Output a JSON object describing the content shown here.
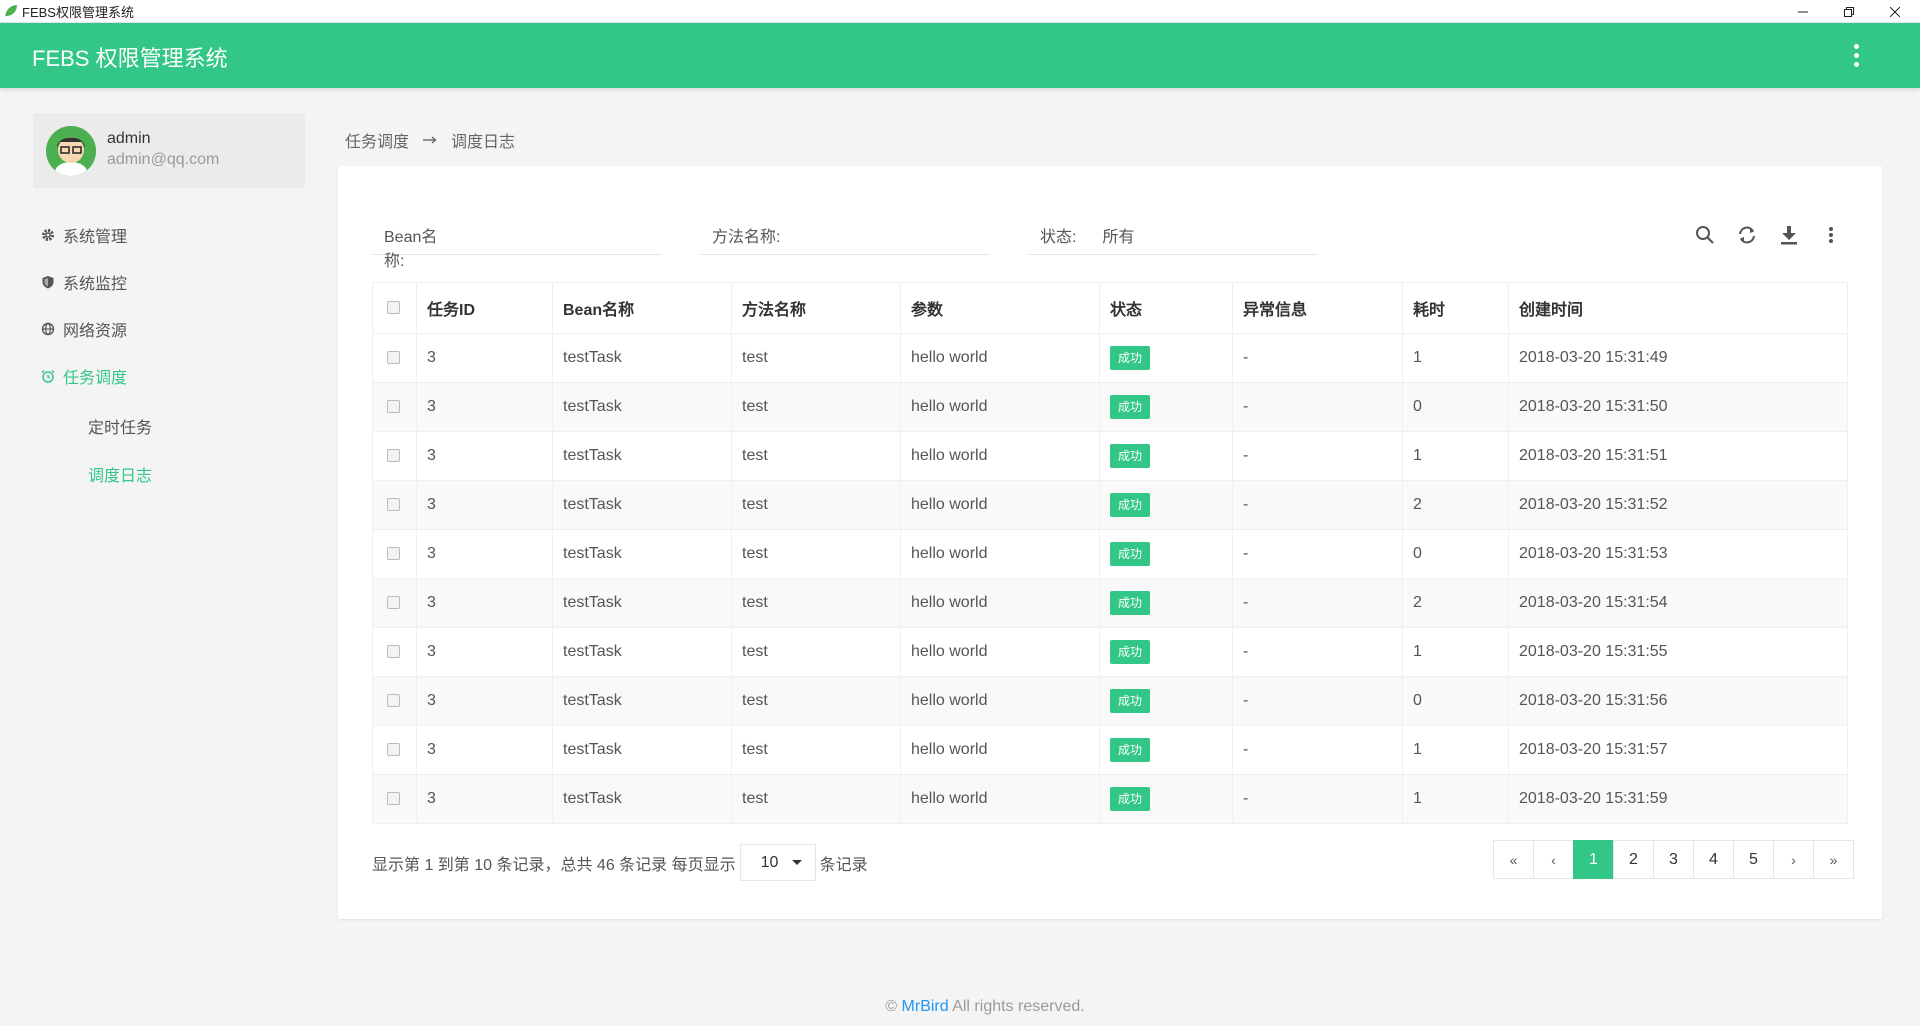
{
  "window": {
    "title": "FEBS权限管理系统"
  },
  "header": {
    "brand": "FEBS 权限管理系统"
  },
  "user": {
    "name": "admin",
    "email": "admin@qq.com"
  },
  "sidebar": {
    "items": [
      {
        "label": "系统管理",
        "icon": "gear-icon"
      },
      {
        "label": "系统监控",
        "icon": "shield-icon"
      },
      {
        "label": "网络资源",
        "icon": "globe-icon"
      },
      {
        "label": "任务调度",
        "icon": "alarm-clock-icon"
      }
    ],
    "subitems": [
      {
        "label": "定时任务"
      },
      {
        "label": "调度日志"
      }
    ]
  },
  "breadcrumb": {
    "parent": "任务调度",
    "current": "调度日志"
  },
  "filters": {
    "bean_label": "Bean名称:",
    "method_label": "方法名称:",
    "status_label": "状态:",
    "status_value": "所有"
  },
  "table": {
    "columns": [
      "任务ID",
      "Bean名称",
      "方法名称",
      "参数",
      "状态",
      "异常信息",
      "耗时",
      "创建时间"
    ],
    "rows": [
      [
        "3",
        "testTask",
        "test",
        "hello world",
        "成功",
        "-",
        "1",
        "2018-03-20 15:31:49"
      ],
      [
        "3",
        "testTask",
        "test",
        "hello world",
        "成功",
        "-",
        "0",
        "2018-03-20 15:31:50"
      ],
      [
        "3",
        "testTask",
        "test",
        "hello world",
        "成功",
        "-",
        "1",
        "2018-03-20 15:31:51"
      ],
      [
        "3",
        "testTask",
        "test",
        "hello world",
        "成功",
        "-",
        "2",
        "2018-03-20 15:31:52"
      ],
      [
        "3",
        "testTask",
        "test",
        "hello world",
        "成功",
        "-",
        "0",
        "2018-03-20 15:31:53"
      ],
      [
        "3",
        "testTask",
        "test",
        "hello world",
        "成功",
        "-",
        "2",
        "2018-03-20 15:31:54"
      ],
      [
        "3",
        "testTask",
        "test",
        "hello world",
        "成功",
        "-",
        "1",
        "2018-03-20 15:31:55"
      ],
      [
        "3",
        "testTask",
        "test",
        "hello world",
        "成功",
        "-",
        "0",
        "2018-03-20 15:31:56"
      ],
      [
        "3",
        "testTask",
        "test",
        "hello world",
        "成功",
        "-",
        "1",
        "2018-03-20 15:31:57"
      ],
      [
        "3",
        "testTask",
        "test",
        "hello world",
        "成功",
        "-",
        "1",
        "2018-03-20 15:31:59"
      ]
    ]
  },
  "pagination": {
    "info_prefix": "显示第 1 到第 10 条记录，总共 46 条记录 每页显示",
    "page_size": "10",
    "info_suffix": "条记录",
    "first": "«",
    "prev": "‹",
    "pages": [
      "1",
      "2",
      "3",
      "4",
      "5"
    ],
    "next": "›",
    "last": "»"
  },
  "footer": {
    "copyright": "©",
    "link": "MrBird",
    "suffix": "All rights reserved."
  },
  "colors": {
    "accent": "#32c787",
    "link": "#2196f3"
  }
}
